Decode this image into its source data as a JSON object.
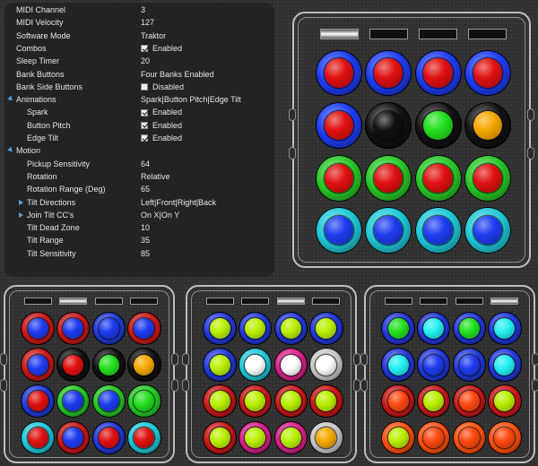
{
  "settings": [
    {
      "label": "MIDI Channel",
      "value": "3",
      "level": 0
    },
    {
      "label": "MIDI Velocity",
      "value": "127",
      "level": 0
    },
    {
      "label": "Software Mode",
      "value": "Traktor",
      "level": 0
    },
    {
      "label": "Combos",
      "value": "Enabled",
      "checkbox": true,
      "checked": true,
      "level": 0
    },
    {
      "label": "Sleep Timer",
      "value": "20",
      "level": 0
    },
    {
      "label": "Bank Buttons",
      "value": "Four Banks Enabled",
      "level": 0
    },
    {
      "label": "Bank Side Buttons",
      "value": "Disabled",
      "checkbox": true,
      "checked": false,
      "level": 0
    },
    {
      "label": "Animations",
      "value": "Spark|Button Pitch|Edge Tilt",
      "level": 0,
      "expander": "expanded"
    },
    {
      "label": "Spark",
      "value": "Enabled",
      "checkbox": true,
      "checked": true,
      "level": 1
    },
    {
      "label": "Button Pitch",
      "value": "Enabled",
      "checkbox": true,
      "checked": true,
      "level": 1
    },
    {
      "label": "Edge Tilt",
      "value": "Enabled",
      "checkbox": true,
      "checked": true,
      "level": 1
    },
    {
      "label": "Motion",
      "value": "",
      "level": 0,
      "expander": "expanded"
    },
    {
      "label": "Pickup Sensitivity",
      "value": "64",
      "level": 1
    },
    {
      "label": "Rotation",
      "value": "Relative",
      "level": 1
    },
    {
      "label": "Rotation Range (Deg)",
      "value": "65",
      "level": 1
    },
    {
      "label": "Tilt Directions",
      "value": "Left|Front|Right|Back",
      "level": 1,
      "expander": "collapsed"
    },
    {
      "label": "Join Tilt CC's",
      "value": "On X|On Y",
      "level": 1,
      "expander": "collapsed"
    },
    {
      "label": "Tilt Dead Zone",
      "value": "10",
      "level": 1
    },
    {
      "label": "Tilt Range",
      "value": "35",
      "level": 1
    },
    {
      "label": "Tilt Sensitivity",
      "value": "85",
      "level": 1
    }
  ],
  "colors": {
    "red": "#e01010",
    "blue": "#1e3cf0",
    "green": "#22e01e",
    "orange": "#f5a800",
    "white": "#ffffff",
    "lime": "#b8f000",
    "cyan": "#22f0f0",
    "orange_red": "#ff4a10",
    "magenta": "#e01890",
    "black": "#111111",
    "cyan_ring": "#20c8d8",
    "green_ring": "#28c828",
    "blue_ring": "#2238d8",
    "red_ring": "#c81818",
    "pink_ring": "#d8208a",
    "orange_ring": "#ff5010",
    "silver_ring": "#c8c8c8"
  },
  "controllers": [
    {
      "name": "main",
      "active_bank": 0,
      "buttons": [
        [
          "red",
          "blue"
        ],
        [
          "red",
          "blue"
        ],
        [
          "red",
          "blue"
        ],
        [
          "red",
          "blue"
        ],
        [
          "red",
          "blue"
        ],
        [
          "black",
          "black"
        ],
        [
          "green",
          "black"
        ],
        [
          "orange",
          "black"
        ],
        [
          "red",
          "green_ring"
        ],
        [
          "red",
          "green_ring"
        ],
        [
          "red",
          "green_ring"
        ],
        [
          "red",
          "green_ring"
        ],
        [
          "blue",
          "cyan_ring"
        ],
        [
          "blue",
          "cyan_ring"
        ],
        [
          "blue",
          "cyan_ring"
        ],
        [
          "blue",
          "cyan_ring"
        ]
      ]
    },
    {
      "name": "bottom-left",
      "active_bank": 1,
      "buttons": [
        [
          "blue",
          "red_ring"
        ],
        [
          "blue",
          "red_ring"
        ],
        [
          "blue",
          "blue_ring"
        ],
        [
          "blue",
          "red_ring"
        ],
        [
          "blue",
          "red_ring"
        ],
        [
          "red",
          "black"
        ],
        [
          "green",
          "black"
        ],
        [
          "orange",
          "black"
        ],
        [
          "red",
          "blue_ring"
        ],
        [
          "blue",
          "green_ring"
        ],
        [
          "blue",
          "green_ring"
        ],
        [
          "green",
          "green_ring"
        ],
        [
          "red",
          "cyan_ring"
        ],
        [
          "blue",
          "red_ring"
        ],
        [
          "red",
          "blue_ring"
        ],
        [
          "red",
          "cyan_ring"
        ]
      ]
    },
    {
      "name": "bottom-middle",
      "active_bank": 2,
      "buttons": [
        [
          "lime",
          "blue_ring"
        ],
        [
          "lime",
          "blue_ring"
        ],
        [
          "lime",
          "blue_ring"
        ],
        [
          "lime",
          "blue_ring"
        ],
        [
          "lime",
          "blue_ring"
        ],
        [
          "white",
          "cyan_ring"
        ],
        [
          "white",
          "pink_ring"
        ],
        [
          "white",
          "silver_ring"
        ],
        [
          "lime",
          "red_ring"
        ],
        [
          "lime",
          "red_ring"
        ],
        [
          "lime",
          "red_ring"
        ],
        [
          "lime",
          "red_ring"
        ],
        [
          "lime",
          "red_ring"
        ],
        [
          "lime",
          "pink_ring"
        ],
        [
          "lime",
          "pink_ring"
        ],
        [
          "orange",
          "silver_ring"
        ]
      ]
    },
    {
      "name": "bottom-right",
      "active_bank": 3,
      "buttons": [
        [
          "green",
          "blue_ring"
        ],
        [
          "cyan",
          "blue_ring"
        ],
        [
          "green",
          "blue_ring"
        ],
        [
          "cyan",
          "blue_ring"
        ],
        [
          "cyan",
          "blue_ring"
        ],
        [
          "blue",
          "blue_ring"
        ],
        [
          "blue",
          "blue_ring"
        ],
        [
          "cyan",
          "blue_ring"
        ],
        [
          "orange_red",
          "red_ring"
        ],
        [
          "lime",
          "red_ring"
        ],
        [
          "orange_red",
          "red_ring"
        ],
        [
          "lime",
          "red_ring"
        ],
        [
          "lime",
          "orange_ring"
        ],
        [
          "orange_red",
          "orange_ring"
        ],
        [
          "orange_red",
          "orange_ring"
        ],
        [
          "orange_red",
          "orange_ring"
        ]
      ]
    }
  ]
}
